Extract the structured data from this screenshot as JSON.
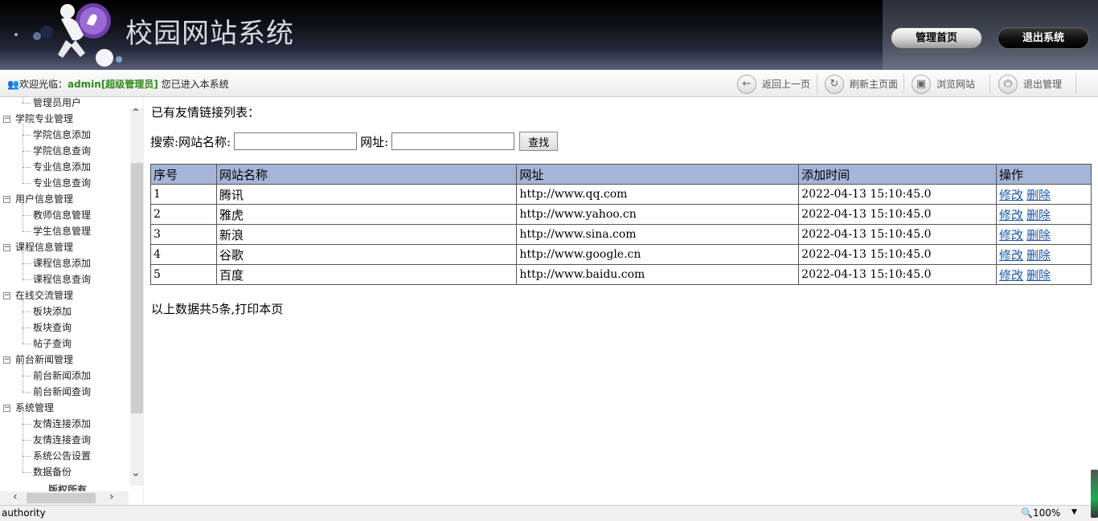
{
  "header": {
    "title": "校园网站系统",
    "home_button": "管理首页",
    "exit_button": "退出系统"
  },
  "statusbar": {
    "welcome_prefix": "欢迎光临：",
    "username": "admin[超级管理员]",
    "welcome_suffix": "您已进入本系统",
    "tools": [
      {
        "label": "返回上一页",
        "icon": "back-arrow-icon"
      },
      {
        "label": "刷新主页面",
        "icon": "refresh-icon"
      },
      {
        "label": "浏览网站",
        "icon": "browse-icon"
      },
      {
        "label": "退出管理",
        "icon": "power-icon"
      }
    ]
  },
  "sidebar": {
    "items": [
      {
        "type": "child",
        "label": "管理员用户"
      },
      {
        "type": "parent",
        "label": "学院专业管理"
      },
      {
        "type": "child",
        "label": "学院信息添加"
      },
      {
        "type": "child",
        "label": "学院信息查询"
      },
      {
        "type": "child",
        "label": "专业信息添加"
      },
      {
        "type": "child",
        "label": "专业信息查询"
      },
      {
        "type": "parent",
        "label": "用户信息管理"
      },
      {
        "type": "child",
        "label": "教师信息管理"
      },
      {
        "type": "child",
        "label": "学生信息管理"
      },
      {
        "type": "parent",
        "label": "课程信息管理"
      },
      {
        "type": "child",
        "label": "课程信息添加"
      },
      {
        "type": "child",
        "label": "课程信息查询"
      },
      {
        "type": "parent",
        "label": "在线交流管理"
      },
      {
        "type": "child",
        "label": "板块添加"
      },
      {
        "type": "child",
        "label": "板块查询"
      },
      {
        "type": "child",
        "label": "帖子查询"
      },
      {
        "type": "parent",
        "label": "前台新闻管理"
      },
      {
        "type": "child",
        "label": "前台新闻添加"
      },
      {
        "type": "child",
        "label": "前台新闻查询"
      },
      {
        "type": "parent",
        "label": "系统管理"
      },
      {
        "type": "child",
        "label": "友情连接添加"
      },
      {
        "type": "child",
        "label": "友情连接查询"
      },
      {
        "type": "child",
        "label": "系统公告设置"
      },
      {
        "type": "child",
        "label": "数据备份"
      }
    ],
    "copyright": "版权所有"
  },
  "main": {
    "list_title": "已有友情链接列表：",
    "search_label": "搜索:网站名称:",
    "url_label": "网址:",
    "search_value": "",
    "url_value": "",
    "search_button": "查找",
    "columns": [
      "序号",
      "网站名称",
      "网址",
      "添加时间",
      "操作"
    ],
    "rows": [
      {
        "id": "1",
        "name": "腾讯",
        "url": "http://www.qq.com",
        "time": "2022-04-13 15:10:45.0"
      },
      {
        "id": "2",
        "name": "雅虎",
        "url": "http://www.yahoo.cn",
        "time": "2022-04-13 15:10:45.0"
      },
      {
        "id": "3",
        "name": "新浪",
        "url": "http://www.sina.com",
        "time": "2022-04-13 15:10:45.0"
      },
      {
        "id": "4",
        "name": "谷歌",
        "url": "http://www.google.cn",
        "time": "2022-04-13 15:10:45.0"
      },
      {
        "id": "5",
        "name": "百度",
        "url": "http://www.baidu.com",
        "time": "2022-04-13 15:10:45.0"
      }
    ],
    "edit_label": "修改",
    "delete_label": "删除",
    "summary": "以上数据共5条,打印本页"
  },
  "browser_status": {
    "text": "authority",
    "zoom": "100%"
  },
  "colors": {
    "table_header": "#a4b5d8",
    "link": "#1a56a8",
    "username": "#2e8b1a"
  }
}
